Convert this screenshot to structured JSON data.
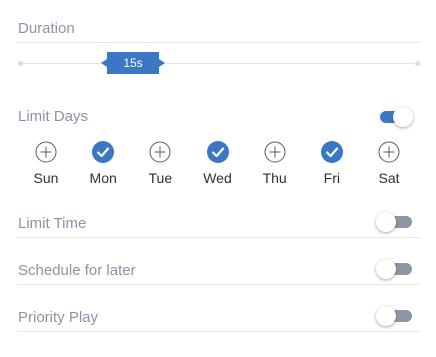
{
  "duration": {
    "label": "Duration",
    "value_label": "15s"
  },
  "limit_days": {
    "label": "Limit Days",
    "enabled": true,
    "days": [
      {
        "name": "Sun",
        "checked": false
      },
      {
        "name": "Mon",
        "checked": true
      },
      {
        "name": "Tue",
        "checked": false
      },
      {
        "name": "Wed",
        "checked": true
      },
      {
        "name": "Thu",
        "checked": false
      },
      {
        "name": "Fri",
        "checked": true
      },
      {
        "name": "Sat",
        "checked": false
      }
    ]
  },
  "limit_time": {
    "label": "Limit Time",
    "enabled": false
  },
  "schedule_later": {
    "label": "Schedule for later",
    "enabled": false
  },
  "priority_play": {
    "label": "Priority Play",
    "enabled": false
  },
  "colors": {
    "accent": "#3a78c3",
    "label": "#8a94a6",
    "toggle_off_track": "#8c96a6",
    "divider": "#e5e7ec"
  },
  "icons": {
    "unchecked": "circle-plus-icon",
    "checked": "circle-check-icon"
  }
}
